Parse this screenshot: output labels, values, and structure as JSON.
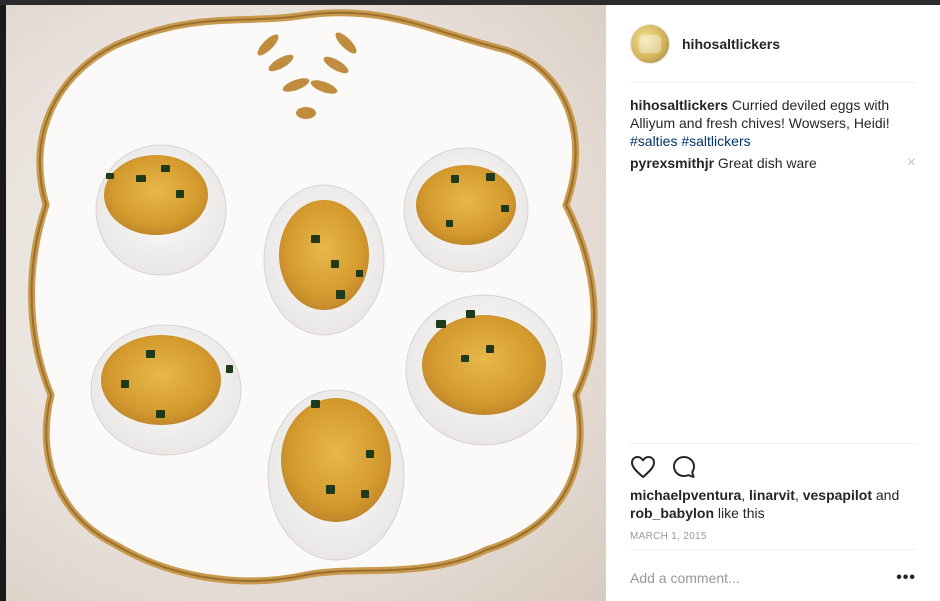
{
  "post": {
    "image_alt": "Deviled eggs on a gold-rimmed white dish",
    "username": "hihosaltlickers"
  },
  "comments": [
    {
      "author": "hihosaltlickers",
      "text": " Curried deviled eggs with Alliyum and fresh chives! Wowsers, Heidi! ",
      "tags": [
        "#salties",
        "#saltlickers"
      ]
    },
    {
      "author": "pyrexsmithjr",
      "text": " Great dish ware",
      "delete_glyph": "×"
    }
  ],
  "actions": {
    "like_icon": "heart-icon",
    "comment_icon": "comment-bubble-icon"
  },
  "likes": {
    "users": [
      "michaelpventura",
      "linarvit",
      "vespapilot",
      "rob_babylon"
    ],
    "sep1": ", ",
    "sep2": ", ",
    "and": " and ",
    "suffix": " like this"
  },
  "date": "MARCH 1, 2015",
  "add_comment": {
    "placeholder": "Add a comment...",
    "more_glyph": "•••"
  }
}
